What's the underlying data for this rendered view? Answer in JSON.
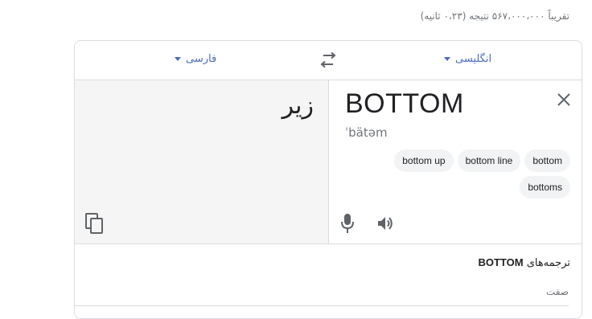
{
  "results_stats": "تقریباً ۵۶۷،۰۰۰،۰۰۰ نتیجه (۰،۲۳ ثانیه)",
  "translator": {
    "target_language": "فارسی",
    "source_language": "انگلیسی",
    "source_text": "BOTTOM",
    "phonetic": "ˈbätəm",
    "translation": "زیر",
    "suggestions": [
      "bottom",
      "bottom line",
      "bottom up",
      "bottoms"
    ]
  },
  "translations_section": {
    "title_prefix": "ترجمه‌های",
    "title_word": "BOTTOM",
    "part_of_speech": "صفت"
  },
  "colors": {
    "link_blue": "#4a6cc5",
    "icon_gray": "#5f6368",
    "border": "#dadce0"
  },
  "icons": [
    "swap-icon",
    "copy-icon",
    "close-icon",
    "microphone-icon",
    "speaker-icon",
    "caret-down-icon"
  ]
}
